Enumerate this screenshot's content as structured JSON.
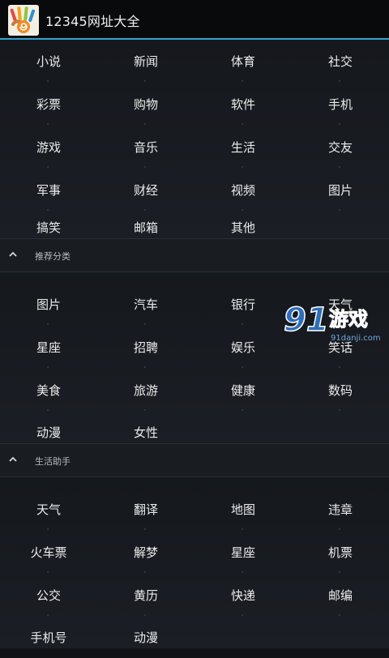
{
  "header": {
    "title": "12345网址大全"
  },
  "sections": [
    {
      "id": "top",
      "items": [
        "小说",
        "新闻",
        "体育",
        "社交",
        "彩票",
        "购物",
        "软件",
        "手机",
        "游戏",
        "音乐",
        "生活",
        "交友",
        "军事",
        "财经",
        "视频",
        "图片",
        "搞笑",
        "邮箱",
        "其他"
      ]
    },
    {
      "id": "recommend",
      "title": "推荐分类",
      "items": [
        "图片",
        "汽车",
        "银行",
        "天气",
        "星座",
        "招聘",
        "娱乐",
        "笑话",
        "美食",
        "旅游",
        "健康",
        "数码",
        "动漫",
        "女性"
      ]
    },
    {
      "id": "life",
      "title": "生活助手",
      "items": [
        "天气",
        "翻译",
        "地图",
        "违章",
        "火车票",
        "解梦",
        "星座",
        "机票",
        "公交",
        "黄历",
        "快递",
        "邮编",
        "手机号",
        "动漫"
      ]
    }
  ],
  "watermark": {
    "text": "91游戏",
    "sub": "91danji.com"
  },
  "colors": {
    "accent": "#34a3d3",
    "background": "#111317",
    "header_bg": "#090a0c",
    "watermark": "#2d6fb8"
  }
}
